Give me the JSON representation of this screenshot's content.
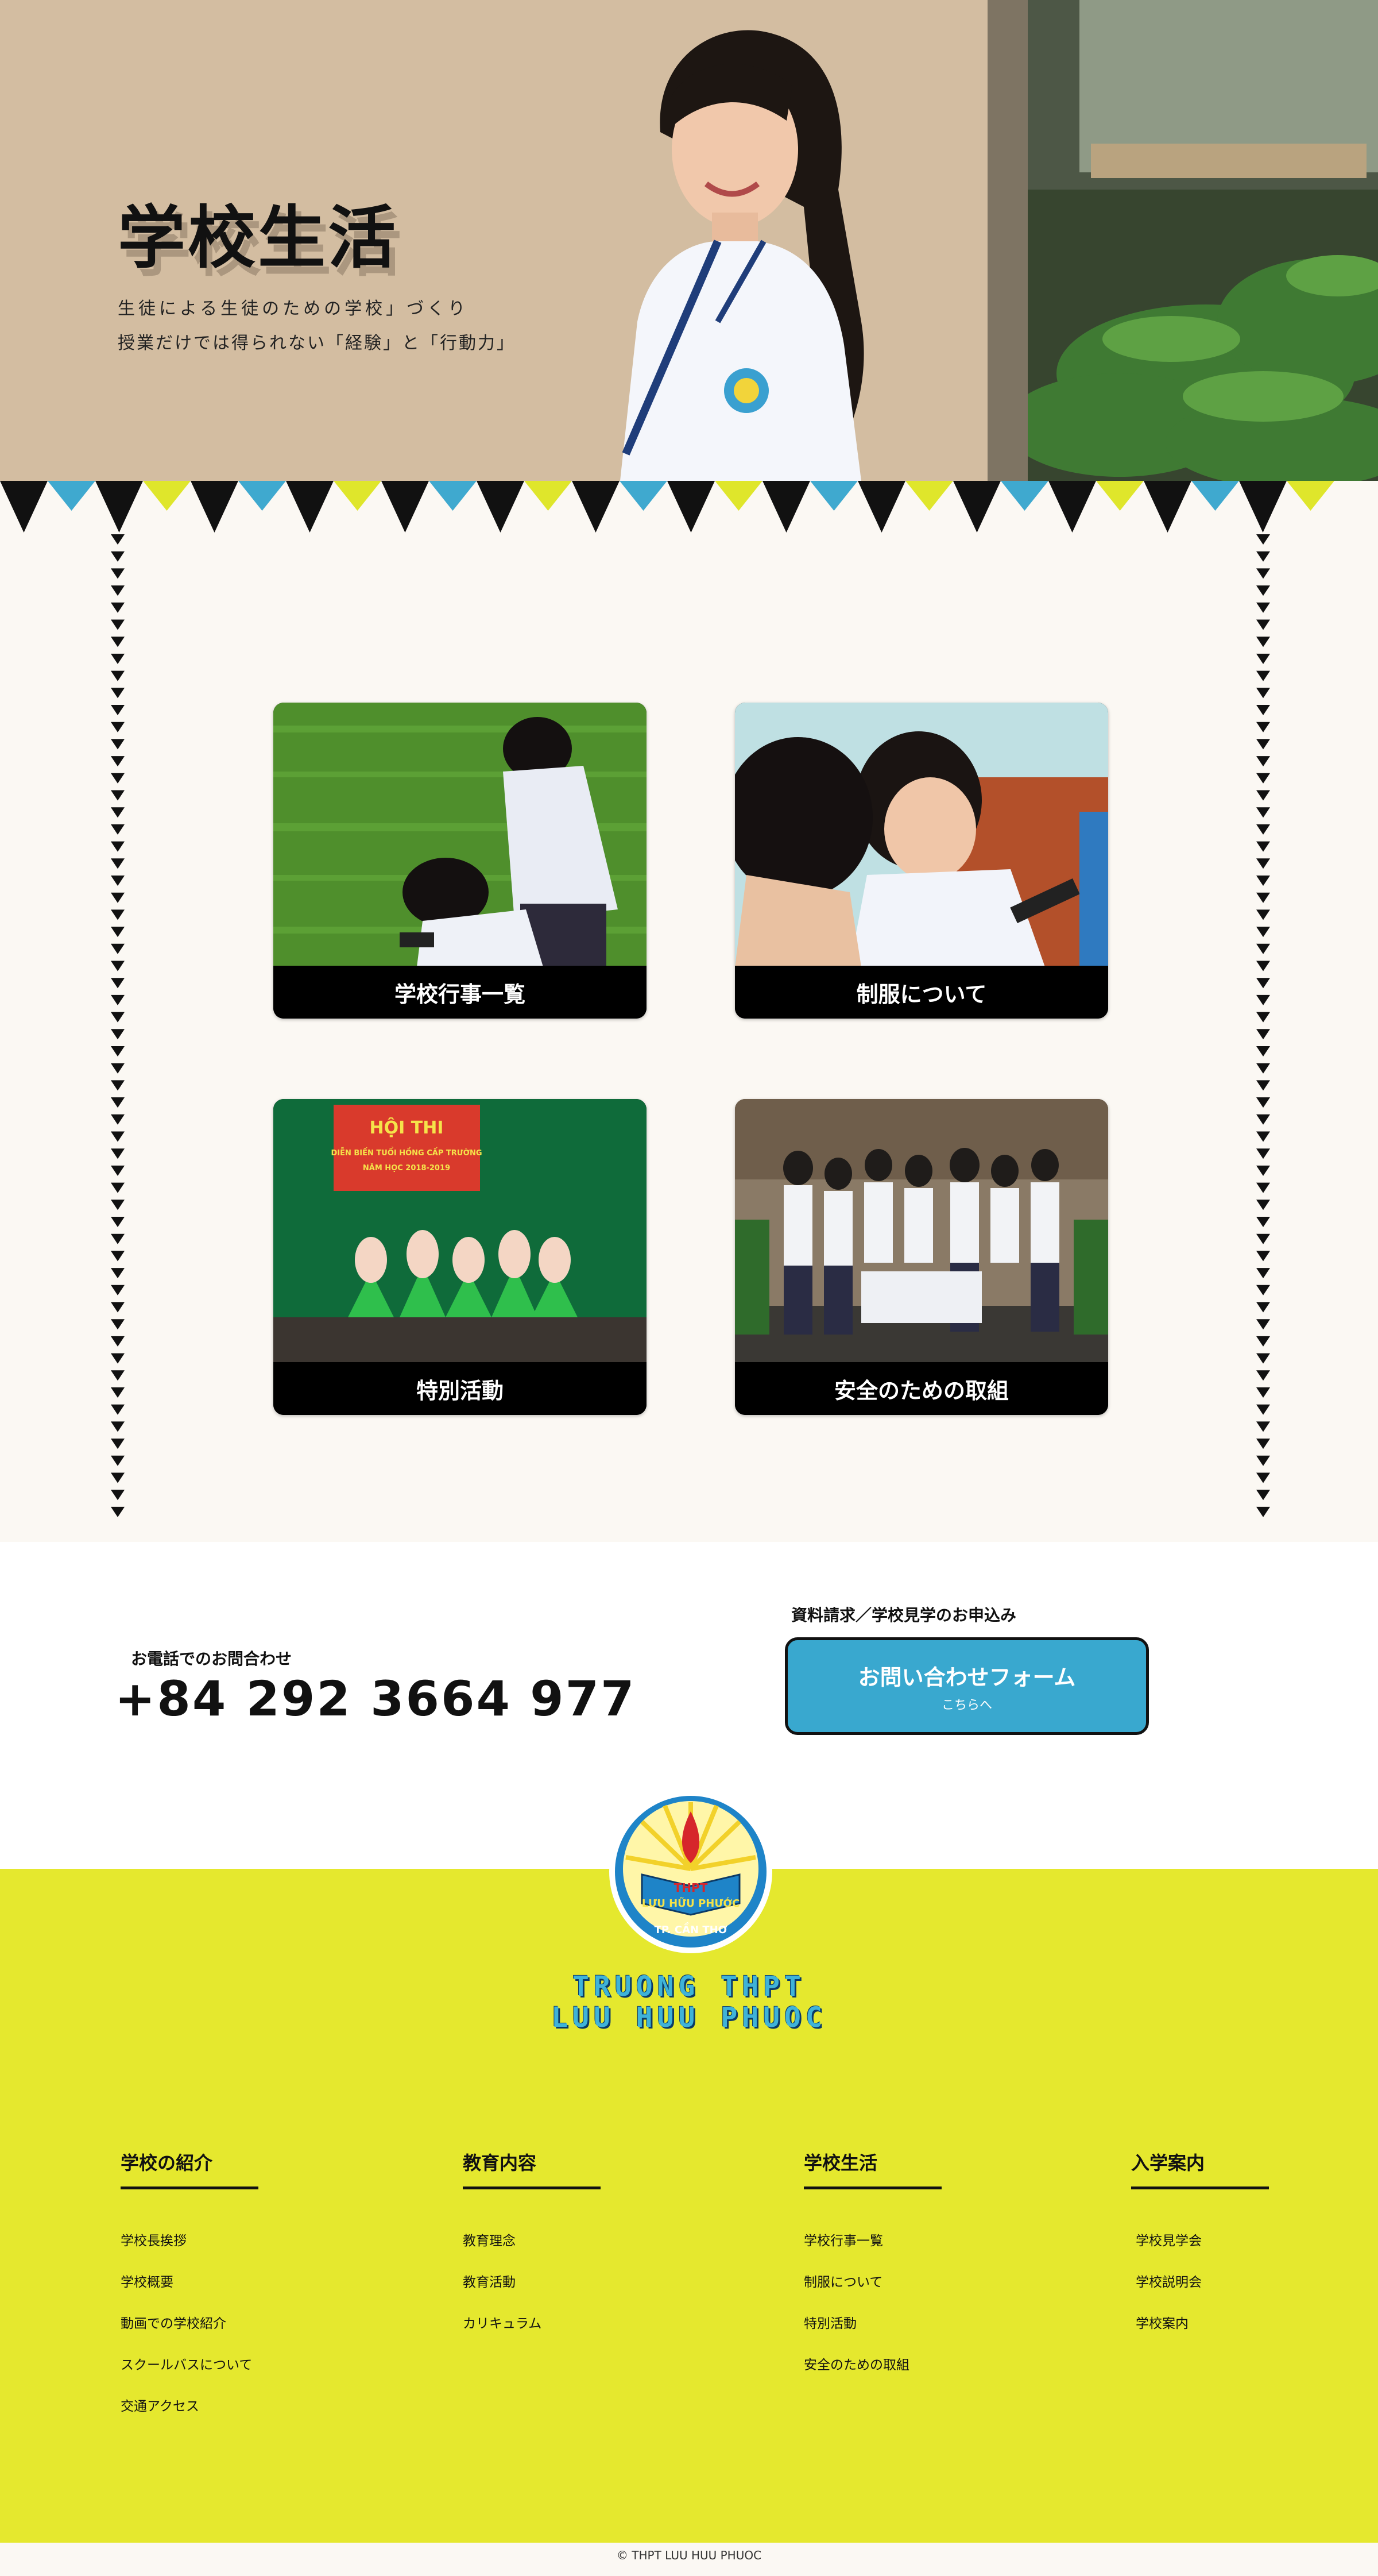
{
  "hero": {
    "title": "学校生活",
    "subtitle_line1": "生徒による生徒のための学校」づくり",
    "subtitle_line2": "授業だけでは得られない「経験」と「行動力」"
  },
  "cards": [
    {
      "label": "学校行事一覧"
    },
    {
      "label": "制服について"
    },
    {
      "label": "特別活動"
    },
    {
      "label": "安全のための取組"
    }
  ],
  "event_banner": {
    "line1": "HỘI THI",
    "line2": "DIỄN BIẾN TUỔI HỒNG CẤP TRƯỜNG",
    "line3": "NĂM HỌC 2018-2019"
  },
  "contact": {
    "phone_label": "お電話でのお問合わせ",
    "phone_number": "+84 292 3664 977",
    "form_label": "資料請求／学校見学のお申込み",
    "form_button_main": "お問い合わせフォーム",
    "form_button_sub": "こちらへ"
  },
  "logo": {
    "badge_top": "THPT",
    "badge_name": "LƯU HỮU PHƯỚC",
    "badge_city": "TP. CẦN THƠ",
    "text_line1": "TRUONG THPT",
    "text_line2": "LUU HUU PHUOC"
  },
  "footer": {
    "columns": [
      {
        "title": "学校の紹介",
        "items": [
          "学校長挨拶",
          "学校概要",
          "動画での学校紹介",
          "スクールバスについて",
          "交通アクセス"
        ]
      },
      {
        "title": "教育内容",
        "items": [
          "教育理念",
          "教育活動",
          "カリキュラム"
        ]
      },
      {
        "title": "学校生活",
        "items": [
          "学校行事一覧",
          "制服について",
          "特別活動",
          "安全のための取組"
        ]
      },
      {
        "title": "入学案内",
        "items": [
          "学校見学会",
          "学校説明会",
          "学校案内"
        ]
      }
    ],
    "copyright": "© THPT LUU HUU PHUOC"
  },
  "colors": {
    "footer_bg": "#e5e82e",
    "accent_blue": "#39a8cf",
    "flag_blue": "#3fa9cf",
    "flag_yellow": "#dfe62b",
    "flag_black": "#111111"
  }
}
